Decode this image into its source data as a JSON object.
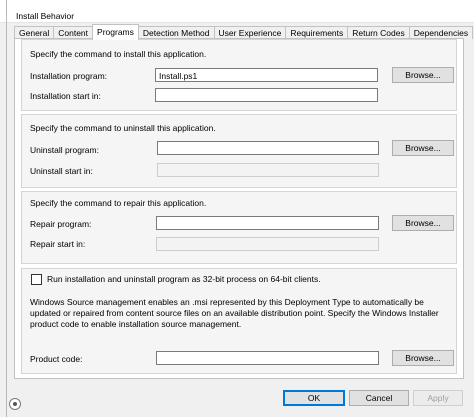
{
  "window": {
    "title": "Install Behavior"
  },
  "tabs": [
    {
      "label": "General"
    },
    {
      "label": "Content"
    },
    {
      "label": "Programs"
    },
    {
      "label": "Detection Method"
    },
    {
      "label": "User Experience"
    },
    {
      "label": "Requirements"
    },
    {
      "label": "Return Codes"
    },
    {
      "label": "Dependencies"
    }
  ],
  "install": {
    "heading": "Specify the command to install this application.",
    "program_label": "Installation program:",
    "program_value": "Install.ps1",
    "start_in_label": "Installation start in:",
    "start_in_value": "",
    "browse_label": "Browse..."
  },
  "uninstall": {
    "heading": "Specify the command to uninstall this application.",
    "program_label": "Uninstall program:",
    "program_value": "",
    "start_in_label": "Uninstall start in:",
    "start_in_value": "",
    "browse_label": "Browse..."
  },
  "repair": {
    "heading": "Specify the command to repair this application.",
    "program_label": "Repair program:",
    "program_value": "",
    "start_in_label": "Repair start in:",
    "start_in_value": "",
    "browse_label": "Browse..."
  },
  "options": {
    "run_32bit_label": "Run installation and uninstall program as 32-bit process on 64-bit clients.",
    "run_32bit_checked": false,
    "source_mgmt_text": "Windows Source management enables an .msi represented by this Deployment Type to automatically be updated or repaired from content source files on an available distribution point. Specify the Windows Installer product code to enable installation source management.",
    "product_code_label": "Product code:",
    "product_code_value": "",
    "browse_label": "Browse..."
  },
  "footer": {
    "ok_label": "OK",
    "cancel_label": "Cancel",
    "apply_label": "Apply"
  },
  "colors": {
    "accent": "#0078d7",
    "panel": "#f5f5f5"
  }
}
